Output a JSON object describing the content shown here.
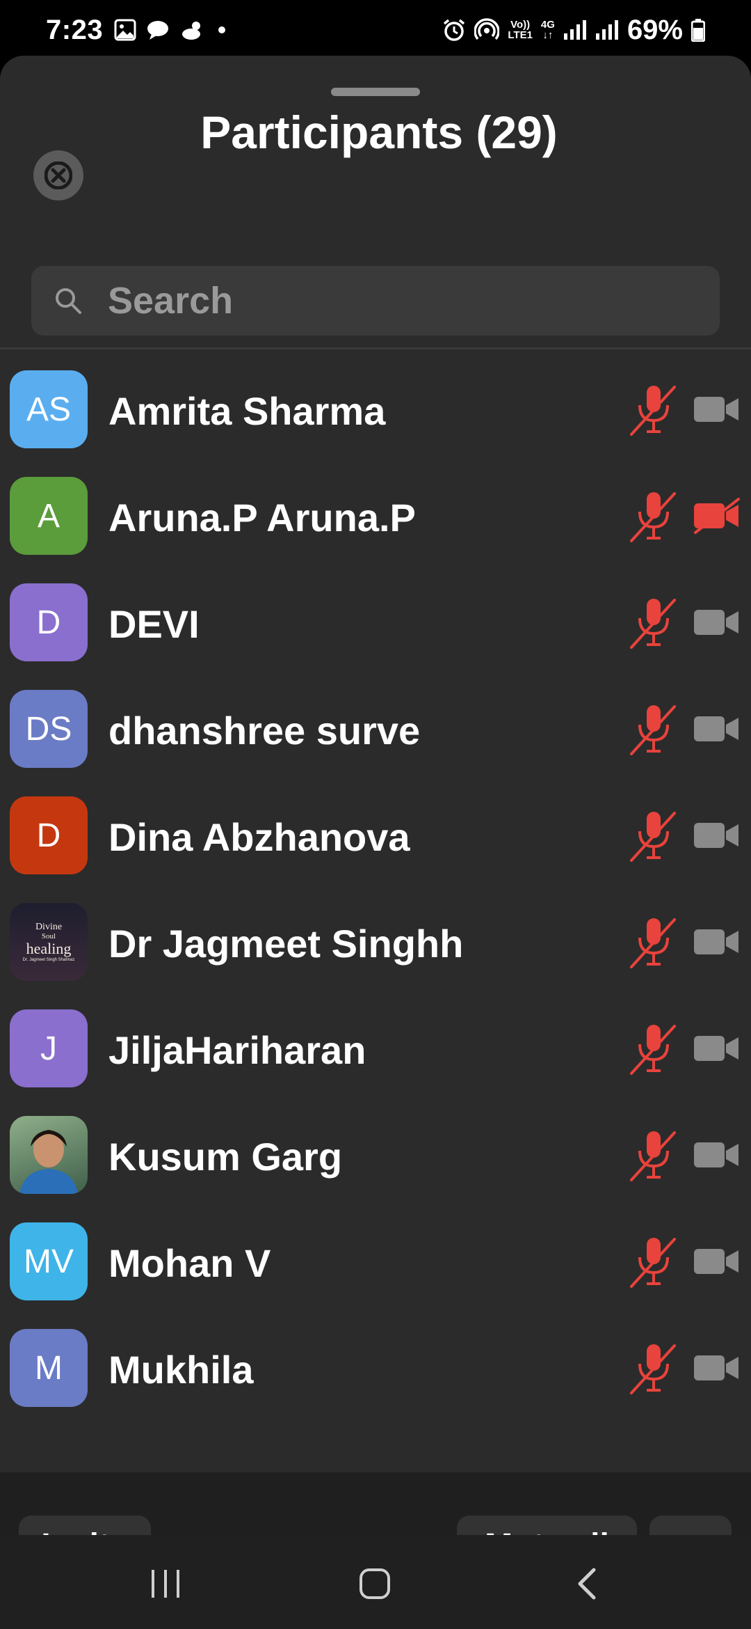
{
  "status_bar": {
    "time": "7:23",
    "network_top": "Vo))",
    "network_bottom": "LTE1",
    "data_top": "4G",
    "data_bottom": "↓↑",
    "battery": "69%"
  },
  "header": {
    "title": "Participants (29)"
  },
  "search": {
    "placeholder": "Search"
  },
  "participants": [
    {
      "name": "Amrita Sharma",
      "initials": "AS",
      "avatar_color": "#5aaef0",
      "mic_muted": true,
      "video_off": false
    },
    {
      "name": "Aruna.P Aruna.P",
      "initials": "A",
      "avatar_color": "#5b9c3b",
      "mic_muted": true,
      "video_off": true
    },
    {
      "name": "DEVI",
      "initials": "D",
      "avatar_color": "#8a6fce",
      "mic_muted": true,
      "video_off": false
    },
    {
      "name": "dhanshree surve",
      "initials": "DS",
      "avatar_color": "#6b7cc6",
      "mic_muted": true,
      "video_off": false
    },
    {
      "name": "Dina Abzhanova",
      "initials": "D",
      "avatar_color": "#c5380f",
      "mic_muted": true,
      "video_off": false
    },
    {
      "name": "Dr Jagmeet Singhh",
      "initials": "",
      "avatar_color": "#2a2a3a",
      "avatar_text_line1": "Divine",
      "avatar_text_line2": "Soul",
      "avatar_text_line3": "healing",
      "avatar_text_line4": "Dr. Jagmeet Singh Shahnaz",
      "mic_muted": true,
      "video_off": false
    },
    {
      "name": "JiljaHariharan",
      "initials": "J",
      "avatar_color": "#8a6fce",
      "mic_muted": true,
      "video_off": false
    },
    {
      "name": "Kusum Garg",
      "initials": "",
      "avatar_color": "#5a7a6a",
      "mic_muted": true,
      "video_off": false
    },
    {
      "name": "Mohan V",
      "initials": "MV",
      "avatar_color": "#3fb4e8",
      "mic_muted": true,
      "video_off": false
    },
    {
      "name": "Mukhila",
      "initials": "M",
      "avatar_color": "#6b7cc6",
      "mic_muted": true,
      "video_off": false
    }
  ],
  "footer": {
    "invite_label": "Invite",
    "mute_all_label": "Mute all",
    "more_label": "···"
  },
  "colors": {
    "muted_red": "#e8433c",
    "icon_gray": "#8a8a8a",
    "sheet_bg": "#2b2b2b"
  },
  "icons": {
    "close": "close-icon",
    "search": "search-icon",
    "mic": "mic-muted-icon",
    "camera": "video-camera-icon"
  }
}
